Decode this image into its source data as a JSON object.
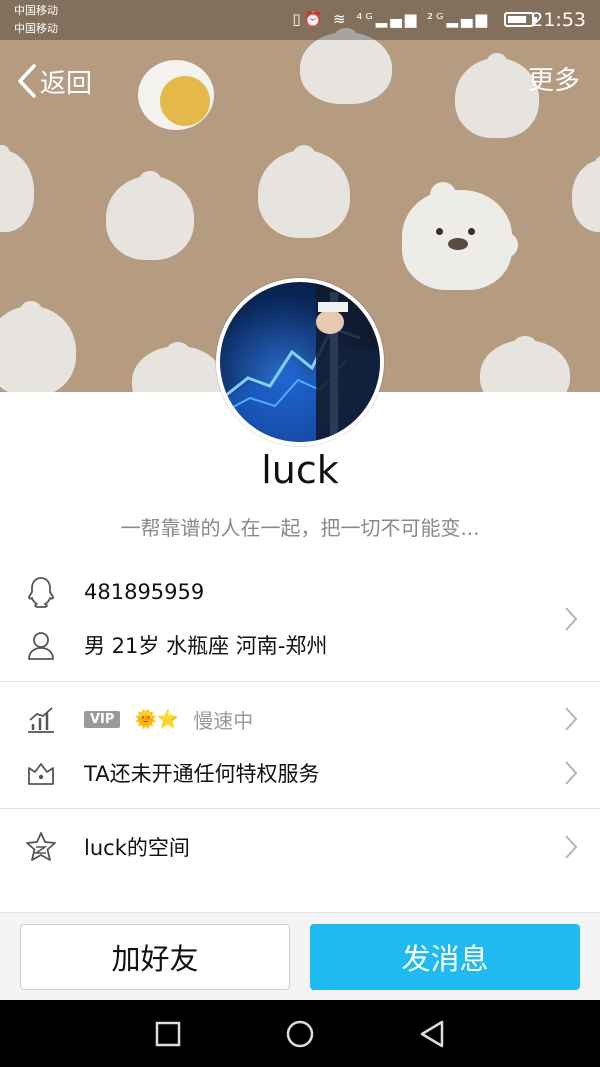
{
  "status_bar": {
    "carrier_1": "中国移动",
    "carrier_2": "中国移动",
    "icons": "▯⏰ ≋ ⁴ᴳ▂▄▆ ²ᴳ▂▄▆",
    "time": "21:53"
  },
  "nav": {
    "back_label": "返回",
    "more_label": "更多"
  },
  "profile": {
    "nickname": "luck",
    "signature": "一帮靠谱的人在一起，把一切不可能变..."
  },
  "info": {
    "qq_number": "481895959",
    "details": "男  21岁  水瓶座  河南-郑州"
  },
  "vip": {
    "badge": "VIP",
    "level_icons": "🌞⭐",
    "status": "慢速中",
    "privilege_text": "TA还未开通任何特权服务"
  },
  "space": {
    "label": "luck的空间"
  },
  "actions": {
    "add_friend": "加好友",
    "send_message": "发消息"
  },
  "colors": {
    "banner": "#b59c80",
    "accent": "#1ebaf0",
    "divider": "#e4e4e4",
    "secondary_text": "#8a8a8a"
  },
  "icons": {
    "back": "chevron-left-icon",
    "qq": "penguin-icon",
    "user": "user-icon",
    "level": "level-chart-icon",
    "privilege": "crown-box-icon",
    "space": "star-icon"
  }
}
